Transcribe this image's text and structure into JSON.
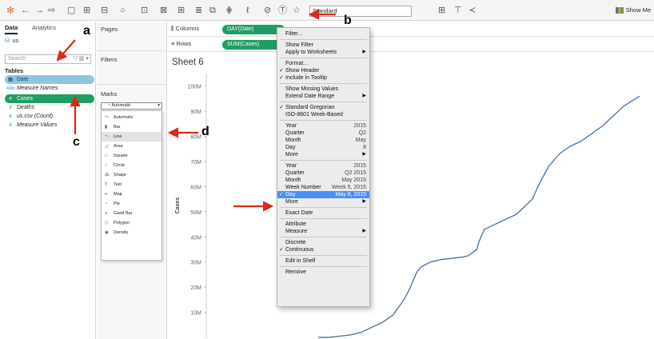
{
  "toolbar": {
    "mark_dropdown_value": "Standard",
    "show_me_label": "Show Me",
    "icons": [
      "tableau-logo-icon",
      "back-icon",
      "forward-icon",
      "redo-icon",
      "save-icon",
      "new-datasource-icon",
      "new-worksheet-icon",
      "duplicate-icon",
      "clear-icon",
      "swap-icon",
      "sort-asc-icon",
      "sort-desc-icon",
      "highlight-icon",
      "group-icon",
      "label-icon",
      "fix-axes-icon",
      "fit-icon",
      "presentation-icon",
      "share-icon"
    ]
  },
  "data_pane": {
    "tabs": [
      "Data",
      "Analytics"
    ],
    "datasource": "us",
    "search_placeholder": "Search",
    "tables_heading": "Tables",
    "fields": [
      {
        "name": "Date",
        "type": "date",
        "icon": "calendar-icon"
      },
      {
        "name": "Measure Names",
        "type": "abc",
        "icon": "abc-icon"
      },
      {
        "name": "Cases",
        "type": "measure",
        "icon": "hash-icon"
      },
      {
        "name": "Deaths",
        "type": "measure",
        "icon": "hash-icon"
      },
      {
        "name": "us.csv (Count)",
        "type": "measure",
        "icon": "hash-icon"
      },
      {
        "name": "Measure Values",
        "type": "measure",
        "icon": "hash-icon"
      }
    ]
  },
  "cards": {
    "pages": "Pages",
    "filters": "Filters",
    "marks": "Marks",
    "marks_dropdown_value": "Automatic",
    "mark_types": [
      "Automatic",
      "Bar",
      "Line",
      "Area",
      "Square",
      "Circle",
      "Shape",
      "Text",
      "Map",
      "Pie",
      "Gantt Bar",
      "Polygon",
      "Density"
    ],
    "mark_types_selected": "Line"
  },
  "shelves": {
    "columns_label": "Columns",
    "columns_pill": "DAY(Date)",
    "rows_label": "Rows",
    "rows_pill": "SUM(Cases)"
  },
  "sheet": {
    "title": "Sheet 6",
    "y_axis_label": "Cases"
  },
  "chart_data": {
    "type": "line",
    "title": "",
    "ylabel": "Cases",
    "ylim": [
      0,
      105
    ],
    "y_tick_labels": [
      "100M",
      "90M",
      "80M",
      "70M",
      "60M",
      "50M",
      "40M",
      "30M",
      "20M",
      "10M"
    ],
    "y_tick_values": [
      100,
      90,
      80,
      70,
      60,
      50,
      40,
      30,
      20,
      10
    ],
    "color": "#4e79a7",
    "x_index": [
      0,
      5,
      10,
      20,
      30,
      40,
      50,
      60,
      70,
      80,
      85,
      88,
      90,
      92,
      94,
      96,
      100,
      105,
      110,
      115,
      125,
      135,
      140,
      148,
      150,
      155,
      165,
      175,
      185,
      200,
      205,
      215,
      225,
      235,
      245,
      255,
      265,
      275,
      285,
      300
    ],
    "y_values": [
      0,
      0,
      0,
      0.5,
      1,
      2,
      4,
      6,
      9,
      15,
      19,
      22,
      24,
      26,
      27,
      28,
      29,
      30,
      30.5,
      31,
      31.5,
      32,
      32.5,
      35,
      38,
      43,
      45,
      47,
      49,
      55,
      60,
      68,
      73,
      76,
      78,
      81,
      84,
      88,
      92,
      96
    ]
  },
  "context_menu": {
    "items": [
      {
        "label": "Filter..."
      },
      {
        "sep": true
      },
      {
        "label": "Show Filter"
      },
      {
        "label": "Apply to Worksheets",
        "submenu": true
      },
      {
        "sep": true
      },
      {
        "label": "Format..."
      },
      {
        "label": "Show Header",
        "checked": true
      },
      {
        "label": "Include in Tooltip",
        "checked": true
      },
      {
        "sep": true
      },
      {
        "label": "Show Missing Values"
      },
      {
        "label": "Extend Date Range",
        "submenu": true
      },
      {
        "sep": true
      },
      {
        "label": "Standard Gregorian",
        "checked": true
      },
      {
        "label": "ISO-8601 Week-Based"
      },
      {
        "sep": true
      },
      {
        "label": "Year",
        "value": "2015"
      },
      {
        "label": "Quarter",
        "value": "Q2"
      },
      {
        "label": "Month",
        "value": "May"
      },
      {
        "label": "Day",
        "value": "8"
      },
      {
        "label": "More",
        "submenu": true
      },
      {
        "sep": true
      },
      {
        "label": "Year",
        "value": "2015"
      },
      {
        "label": "Quarter",
        "value": "Q2 2015"
      },
      {
        "label": "Month",
        "value": "May 2015"
      },
      {
        "label": "Week Number",
        "value": "Week 5, 2015"
      },
      {
        "label": "Day",
        "value": "May 8, 2015",
        "checked": true,
        "highlighted": true
      },
      {
        "label": "More",
        "submenu": true
      },
      {
        "sep": true
      },
      {
        "label": "Exact Date"
      },
      {
        "sep": true
      },
      {
        "label": "Attribute"
      },
      {
        "label": "Measure",
        "submenu": true
      },
      {
        "sep": true
      },
      {
        "label": "Discrete"
      },
      {
        "label": "Continuous",
        "checked": true
      },
      {
        "sep": true
      },
      {
        "label": "Edit in Shelf"
      },
      {
        "sep": true
      },
      {
        "label": "Remove"
      }
    ]
  },
  "annotations": {
    "a": "a",
    "b": "b",
    "c": "c",
    "d": "d",
    "arrow_color": "#e0261b"
  },
  "glyphs": {
    "check": "✓",
    "submenu": "▶",
    "dropdown": "▾"
  }
}
